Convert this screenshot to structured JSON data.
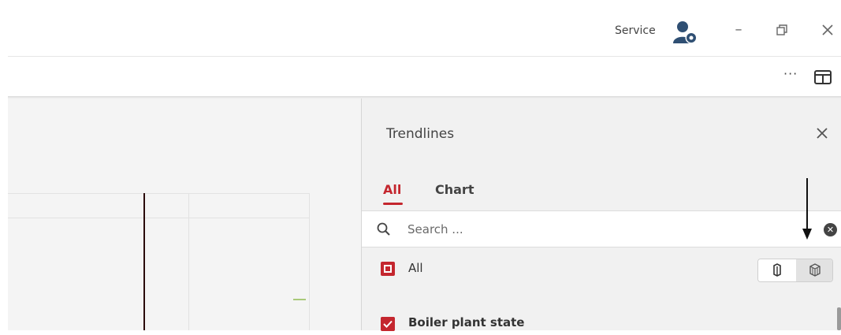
{
  "titlebar": {
    "service_label": "Service",
    "avatar_icon": "user-settings-icon",
    "minimize_icon": "minimize-icon",
    "restore_icon": "restore-icon",
    "close_icon": "close-icon"
  },
  "toolbar": {
    "more_label": "···",
    "panel_toggle_icon": "panel-toggle-icon"
  },
  "trendlines": {
    "title": "Trendlines",
    "close_icon": "close-icon",
    "tabs": [
      {
        "label": "All",
        "active": true
      },
      {
        "label": "Chart",
        "active": false
      }
    ],
    "search": {
      "placeholder": "Search ...",
      "value": ""
    },
    "all_row": {
      "label": "All",
      "checked": "partial"
    },
    "view_toggle": {
      "options": [
        "single-cube-icon",
        "multi-cube-icon"
      ],
      "selected": 1
    },
    "items": [
      {
        "label": "Boiler plant state",
        "checked": true
      }
    ]
  },
  "colors": {
    "accent": "#c4262e",
    "panel_bg": "#f1f1f1",
    "chart_bg": "#f4f4f4",
    "trend_green": "#a9c97a"
  }
}
